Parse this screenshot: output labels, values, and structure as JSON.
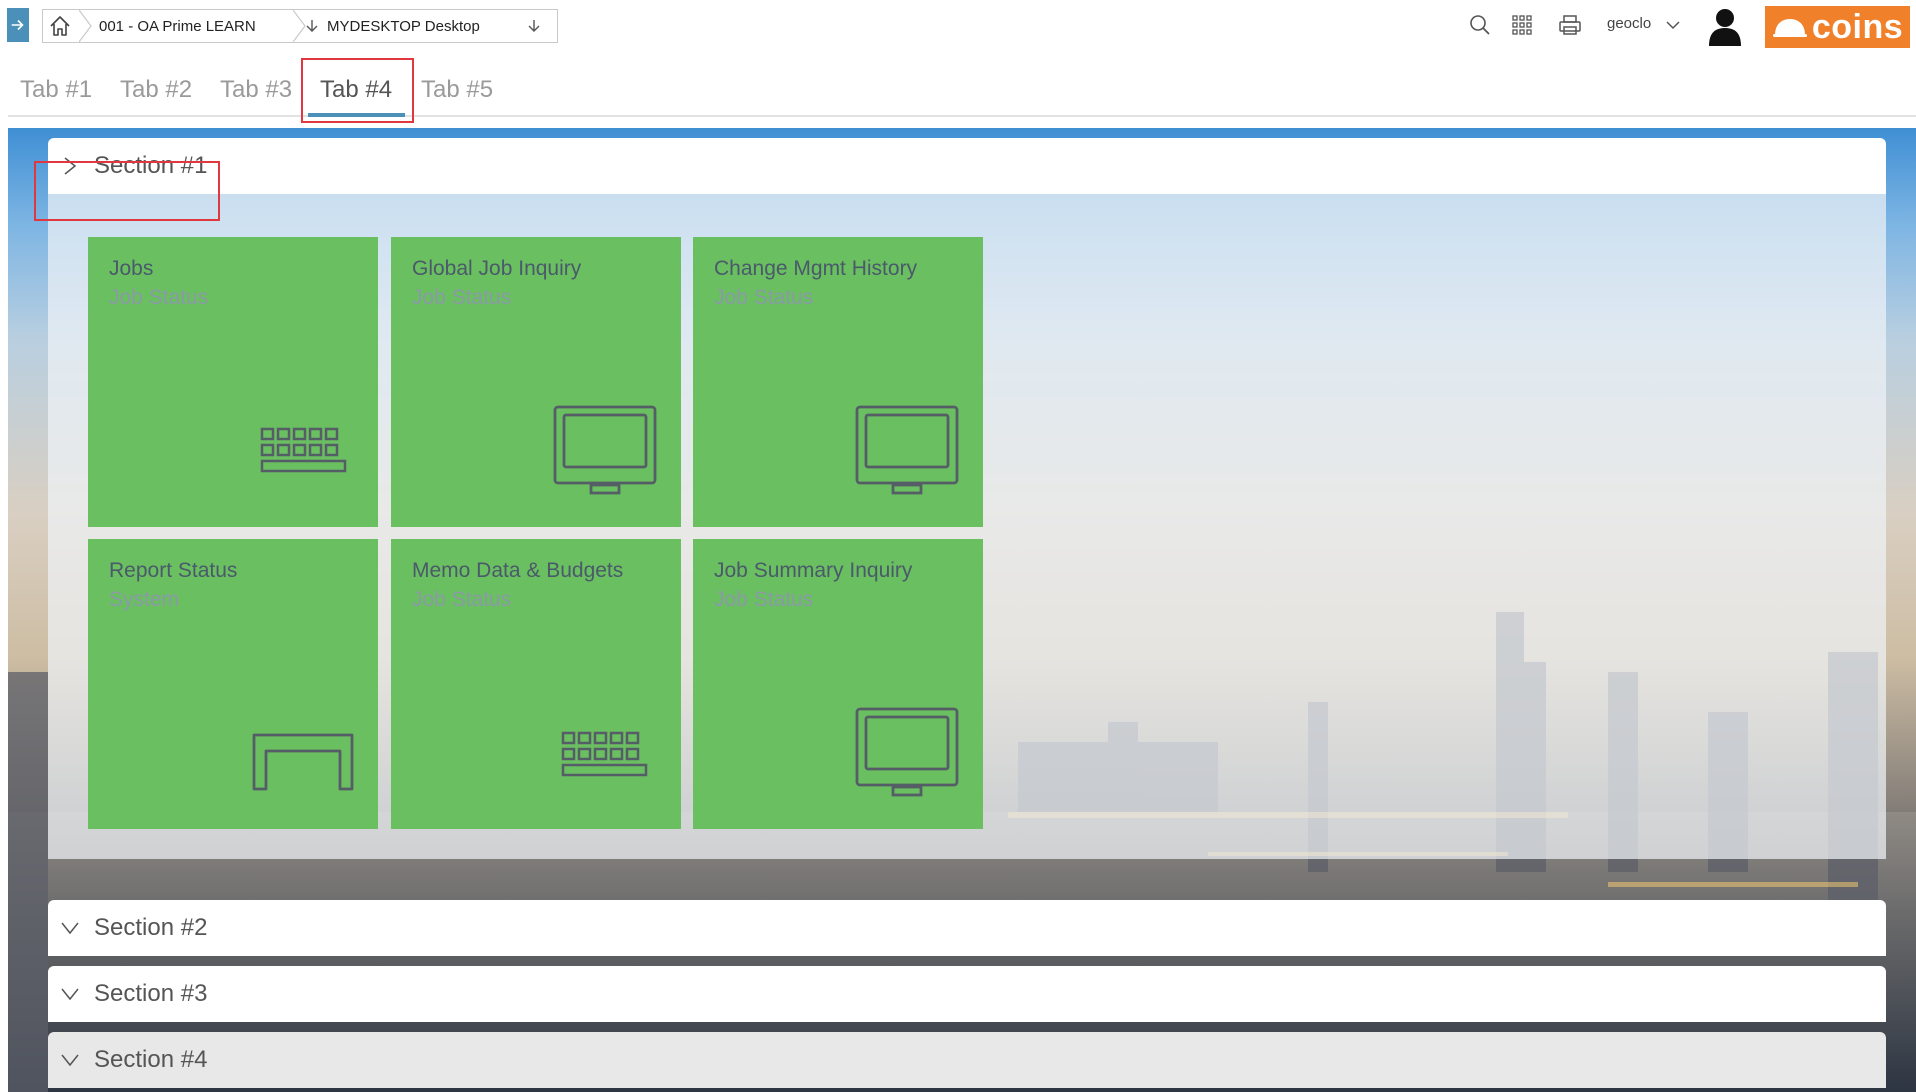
{
  "breadcrumb": {
    "company": "001 - OA Prime LEARN",
    "desktop": "MYDESKTOP Desktop"
  },
  "header": {
    "user": "geoclo",
    "logo_text": "coins"
  },
  "tabs": [
    {
      "label": "Tab #1"
    },
    {
      "label": "Tab #2"
    },
    {
      "label": "Tab #3"
    },
    {
      "label": "Tab #4"
    },
    {
      "label": "Tab #5"
    }
  ],
  "active_tab": "Tab #4",
  "sections": [
    {
      "title": "Section #1",
      "expanded": true
    },
    {
      "title": "Section #2",
      "expanded": false
    },
    {
      "title": "Section #3",
      "expanded": false
    },
    {
      "title": "Section #4",
      "expanded": false
    }
  ],
  "tiles": [
    {
      "title": "Jobs",
      "subtitle": "Job Status",
      "icon": "keyboard-icon"
    },
    {
      "title": "Global Job Inquiry",
      "subtitle": "Job Status",
      "icon": "monitor-icon"
    },
    {
      "title": "Change Mgmt History",
      "subtitle": "Job Status",
      "icon": "monitor-icon"
    },
    {
      "title": "Report Status",
      "subtitle": "System",
      "icon": "table-icon"
    },
    {
      "title": "Memo Data & Budgets",
      "subtitle": "Job Status",
      "icon": "keyboard-icon"
    },
    {
      "title": "Job Summary Inquiry",
      "subtitle": "Job Status",
      "icon": "monitor-icon"
    }
  ],
  "colors": {
    "tile_green": "#6abf61",
    "accent_blue": "#4a90b8",
    "logo_orange": "#f0802a",
    "highlight_red": "#e0383e"
  }
}
